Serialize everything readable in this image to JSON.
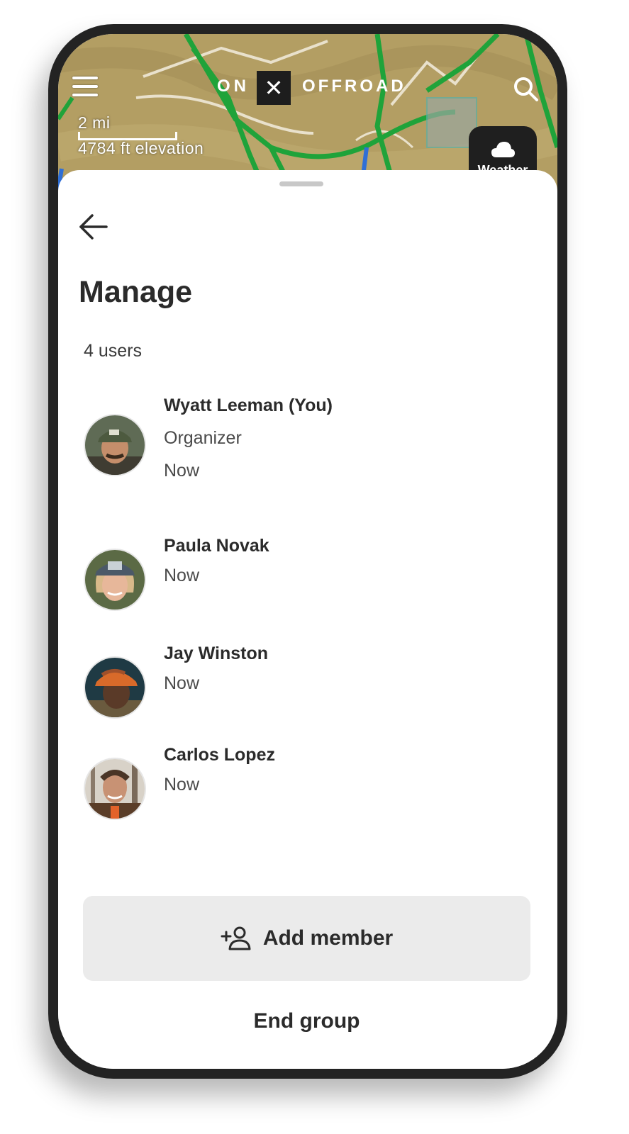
{
  "map": {
    "logo_left": "ON",
    "logo_mark": "✕",
    "logo_right": "OFFROAD",
    "scale_label": "2 mi",
    "elevation_label": "4784 ft elevation",
    "weather_label": "Weather",
    "menu_icon": "hamburger-icon",
    "search_icon": "search-icon",
    "weather_icon": "cloud-icon"
  },
  "sheet": {
    "back_icon": "arrow-left-icon",
    "title": "Manage",
    "user_count": "4 users",
    "members": [
      {
        "name": "Wyatt Leeman (You)",
        "role": "Organizer",
        "status": "Now"
      },
      {
        "name": "Paula Novak",
        "status": "Now"
      },
      {
        "name": "Jay Winston",
        "status": "Now"
      },
      {
        "name": "Carlos Lopez",
        "status": "Now"
      }
    ],
    "add_member_label": "Add member",
    "add_member_icon": "add-person-icon",
    "end_group_label": "End group"
  },
  "colors": {
    "trail_green": "#1fa33a",
    "map_base": "#b39e63",
    "button_bg": "#ebebeb",
    "text_dark": "#2b2b2b"
  }
}
